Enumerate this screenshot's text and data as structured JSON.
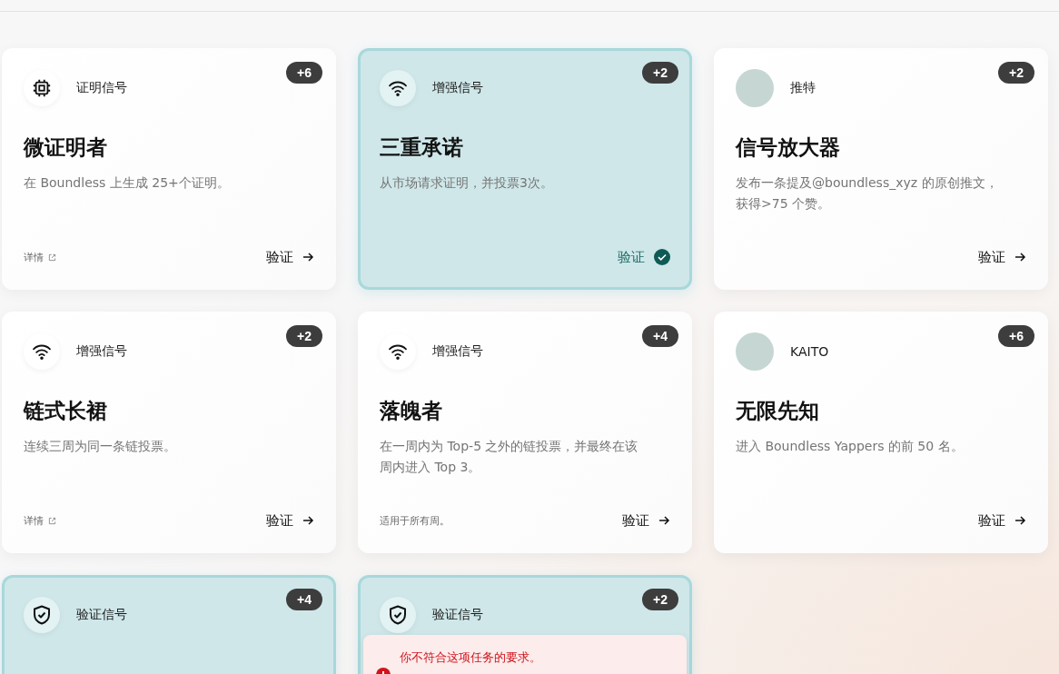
{
  "cards": [
    {
      "kind": "chip",
      "category": "证明信号",
      "points": "+6",
      "title": "微证明者",
      "description": "在 Boundless 上生成 25+个证明。",
      "note": {
        "kind": "link",
        "text": "详情"
      },
      "action": "验证",
      "highlighted": false,
      "verified": false
    },
    {
      "kind": "wifi",
      "category": "增强信号",
      "points": "+2",
      "title": "三重承诺",
      "description": "从市场请求证明，并投票3次。",
      "action": "验证",
      "highlighted": true,
      "verified": true
    },
    {
      "kind": "avatar",
      "category": "推特",
      "points": "+2",
      "title": "信号放大器",
      "description": "发布一条提及@boundless_xyz 的原创推文，获得>75 个赞。",
      "action": "验证",
      "highlighted": false,
      "verified": false
    },
    {
      "kind": "wifi",
      "category": "增强信号",
      "points": "+2",
      "title": "链式长裙",
      "description": "连续三周为同一条链投票。",
      "note": {
        "kind": "link",
        "text": "详情"
      },
      "action": "验证",
      "highlighted": false,
      "verified": false
    },
    {
      "kind": "wifi",
      "category": "增强信号",
      "points": "+4",
      "title": "落魄者",
      "description": "在一周内为 Top-5 之外的链投票，并最终在该周内进入 Top 3。",
      "note": {
        "kind": "text",
        "text": "适用于所有周。"
      },
      "action": "验证",
      "highlighted": false,
      "verified": false
    },
    {
      "kind": "avatar",
      "category": "KAITO",
      "points": "+6",
      "title": "无限先知",
      "description": "进入 Boundless Yappers 的前 50 名。",
      "action": "验证",
      "highlighted": false,
      "verified": false
    },
    {
      "kind": "shield",
      "category": "验证信号",
      "points": "+4",
      "highlighted": true
    },
    {
      "kind": "shield",
      "category": "验证信号",
      "points": "+2",
      "highlighted": true,
      "error": "你不符合这项任务的要求。"
    }
  ]
}
